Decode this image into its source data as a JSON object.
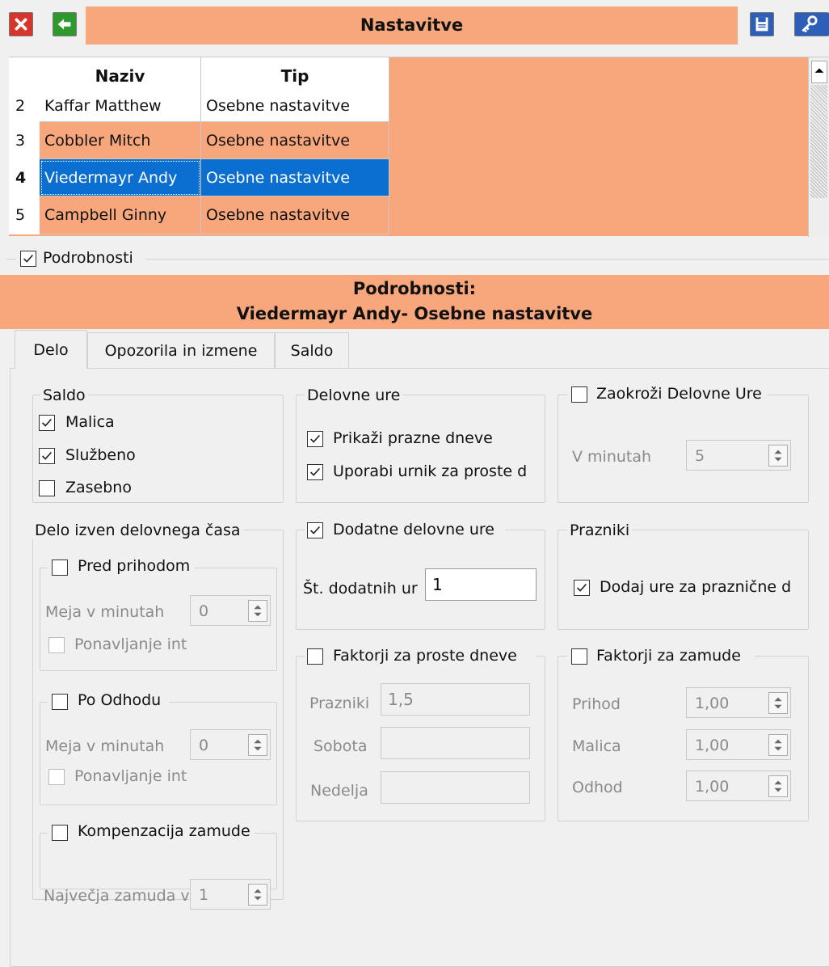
{
  "window": {
    "title": "Nastavitve"
  },
  "toolbar": {
    "close_icon": "close-icon",
    "back_icon": "arrow-left-icon",
    "save_icon": "save-icon",
    "key_icon": "key-icon"
  },
  "grid": {
    "columns": [
      "Naziv",
      "Tip"
    ],
    "rows": [
      {
        "num": "2",
        "naziv": "Kaffar Matthew",
        "tip": "Osebne nastavitve"
      },
      {
        "num": "3",
        "naziv": "Cobbler Mitch",
        "tip": "Osebne nastavitve"
      },
      {
        "num": "4",
        "naziv": "Viedermayr Andy",
        "tip": "Osebne nastavitve"
      },
      {
        "num": "5",
        "naziv": "Campbell Ginny",
        "tip": "Osebne nastavitve"
      }
    ]
  },
  "details_toggle": {
    "label": "Podrobnosti",
    "checked": true
  },
  "details_header": {
    "line1": "Podrobnosti:",
    "line2": "Viedermayr Andy- Osebne nastavitve"
  },
  "tabs": [
    "Delo",
    "Opozorila in izmene",
    "Saldo"
  ],
  "saldo": {
    "title": "Saldo",
    "items": [
      {
        "label": "Malica",
        "checked": true
      },
      {
        "label": "Službeno",
        "checked": true
      },
      {
        "label": "Zasebno",
        "checked": false
      }
    ]
  },
  "delovne_ure": {
    "title": "Delovne ure",
    "items": [
      {
        "label": "Prikaži prazne dneve",
        "checked": true
      },
      {
        "label": "Uporabi urnik za proste d",
        "checked": true
      }
    ]
  },
  "zaokrozi": {
    "title": "Zaokroži Delovne Ure",
    "checked": false,
    "field_label": "V minutah",
    "value": "5"
  },
  "delo_izven": {
    "title": "Delo izven delovnega časa",
    "pred_prihodom": {
      "title": "Pred prihodom",
      "field_label": "Meja v minutah",
      "value": "0",
      "repeat_label": "Ponavljanje int"
    },
    "po_odhodu": {
      "title": "Po Odhodu",
      "field_label": "Meja v minutah",
      "value": "0",
      "repeat_label": "Ponavljanje int"
    },
    "kompenzacija": {
      "title": "Kompenzacija zamude",
      "field_label": "Največja zamuda v",
      "value": "1"
    }
  },
  "dodatne": {
    "title": "Dodatne delovne ure",
    "checked": true,
    "field_label": "Št. dodatnih ur",
    "value": "1"
  },
  "prazniki": {
    "title": "Prazniki",
    "item": "Dodaj ure za praznične d",
    "checked": true
  },
  "faktorji_prosti": {
    "title": "Faktorji za proste dneve",
    "rows": [
      {
        "label": "Prazniki",
        "value": "1,5"
      },
      {
        "label": "Sobota",
        "value": ""
      },
      {
        "label": "Nedelja",
        "value": ""
      }
    ]
  },
  "faktorji_zamude": {
    "title": "Faktorji za zamude",
    "rows": [
      {
        "label": "Prihod",
        "value": "1,00"
      },
      {
        "label": "Malica",
        "value": "1,00"
      },
      {
        "label": "Odhod",
        "value": "1,00"
      }
    ]
  },
  "colors": {
    "accent": "#f7a77b",
    "selection": "#0a6fd0"
  }
}
